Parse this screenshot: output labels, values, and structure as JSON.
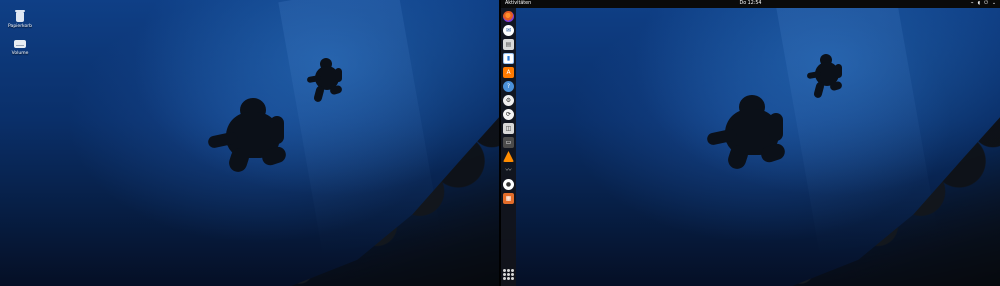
{
  "left_screen": {
    "desktop_icons": [
      {
        "label": "Papierkorb",
        "icon": "trash-icon"
      },
      {
        "label": "Volume",
        "icon": "volume-icon"
      }
    ]
  },
  "right_screen": {
    "topbar": {
      "activities": "Aktivitäten",
      "clock": "Do 12:54",
      "status_icons": [
        "network-icon",
        "volume-icon",
        "power-icon",
        "chevron-down-icon"
      ]
    },
    "dock": {
      "apps": [
        {
          "name": "firefox-icon",
          "glyph": ""
        },
        {
          "name": "chat-icon",
          "glyph": "✉"
        },
        {
          "name": "files-icon",
          "glyph": "▤"
        },
        {
          "name": "writer-icon",
          "glyph": "▮"
        },
        {
          "name": "software-center-icon",
          "glyph": "A"
        },
        {
          "name": "help-icon",
          "glyph": "?"
        },
        {
          "name": "settings-icon",
          "glyph": "⚙"
        },
        {
          "name": "updates-icon",
          "glyph": "⟳"
        },
        {
          "name": "games-icon",
          "glyph": "◫"
        },
        {
          "name": "drive-icon",
          "glyph": "▭"
        },
        {
          "name": "vlc-icon",
          "glyph": ""
        },
        {
          "name": "sheep-icon",
          "glyph": "〰"
        },
        {
          "name": "disc-icon",
          "glyph": "●"
        },
        {
          "name": "archive-icon",
          "glyph": "▦"
        }
      ],
      "apps_grid_icon": "apps-grid-icon"
    }
  }
}
